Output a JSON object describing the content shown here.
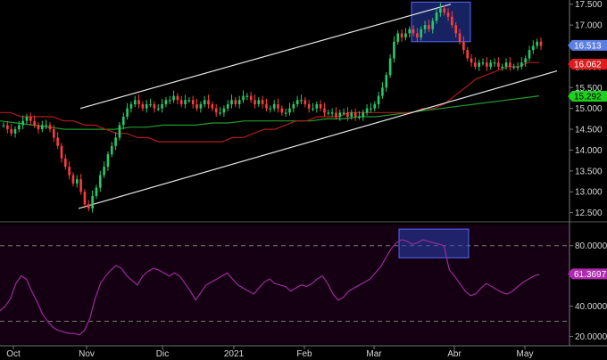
{
  "chart_data": [
    {
      "type": "candlestick",
      "panel": "price",
      "x_ticks": [
        "Oct",
        "Nov",
        "Dic",
        "2021",
        "Feb",
        "Mar",
        "Abr",
        "May"
      ],
      "y_ticks": [
        "12.500",
        "13.000",
        "13.500",
        "14.000",
        "14.500",
        "15.000",
        "15.500",
        "16.000",
        "16.500",
        "17.000",
        "17.500"
      ],
      "ylim": [
        12.3,
        17.6
      ],
      "labels": {
        "last": "16.513",
        "ma_fast": "16.062",
        "ma_slow": "15.292"
      },
      "colors": {
        "up": "#26c96a",
        "down": "#ff3b3b",
        "ma_fast": "#b01c1c",
        "ma_slow": "#1f9a2a",
        "channel": "#e6e6e6",
        "box_fill": "#2a3fb0",
        "box_edge": "#5566ff",
        "last_badge": "#5b7fe6",
        "ma_fast_badge": "#e01b1b",
        "ma_slow_badge": "#1fd01f"
      },
      "close_series": [
        14.6,
        14.5,
        14.4,
        14.5,
        14.6,
        14.7,
        14.8,
        14.7,
        14.6,
        14.5,
        14.6,
        14.6,
        14.5,
        14.3,
        14.1,
        13.8,
        13.6,
        13.4,
        13.2,
        13.3,
        13.0,
        12.7,
        12.6,
        12.9,
        13.1,
        13.4,
        13.6,
        13.9,
        14.1,
        14.3,
        14.6,
        14.8,
        15.0,
        15.1,
        15.2,
        15.1,
        15.0,
        15.1,
        15.1,
        15.0,
        15.0,
        15.1,
        15.2,
        15.2,
        15.3,
        15.2,
        15.1,
        15.2,
        15.2,
        15.1,
        15.0,
        15.1,
        15.2,
        15.1,
        15.0,
        14.9,
        14.9,
        15.0,
        15.1,
        15.2,
        15.1,
        15.2,
        15.3,
        15.3,
        15.2,
        15.1,
        15.2,
        15.1,
        15.0,
        15.0,
        15.1,
        15.0,
        14.9,
        14.9,
        15.0,
        15.1,
        15.2,
        15.2,
        15.1,
        15.0,
        15.0,
        15.1,
        15.0,
        14.9,
        14.9,
        14.9,
        14.8,
        14.9,
        14.9,
        14.8,
        14.9,
        14.8,
        14.8,
        14.9,
        15.0,
        15.0,
        15.1,
        15.3,
        15.5,
        15.8,
        16.2,
        16.6,
        16.8,
        16.7,
        16.8,
        16.9,
        16.8,
        16.7,
        16.9,
        17.0,
        16.9,
        17.1,
        17.3,
        17.4,
        17.3,
        17.2,
        17.0,
        16.8,
        16.6,
        16.4,
        16.2,
        16.1,
        16.0,
        16.1,
        16.1,
        16.0,
        16.1,
        16.1,
        16.0,
        16.0,
        16.1,
        16.0,
        16.0,
        16.0,
        16.1,
        16.2,
        16.4,
        16.5,
        16.6,
        16.5
      ],
      "ma_fast_series": [
        14.9,
        14.9,
        14.8,
        14.8,
        14.8,
        14.8,
        14.7,
        14.7,
        14.6,
        14.6,
        14.5,
        14.4,
        14.4,
        14.3,
        14.3,
        14.2,
        14.2,
        14.2,
        14.2,
        14.2,
        14.2,
        14.2,
        14.3,
        14.3,
        14.4,
        14.5,
        14.5,
        14.6,
        14.7,
        14.7,
        14.8,
        14.8,
        14.8,
        14.9,
        14.9,
        14.9,
        14.9,
        14.9,
        14.9,
        14.9,
        15.0,
        15.0,
        15.1,
        15.3,
        15.5,
        15.7,
        15.8,
        15.9,
        16.0,
        16.0,
        16.1,
        16.1
      ],
      "ma_slow_series": [
        14.7,
        14.65,
        14.6,
        14.55,
        14.5,
        14.5,
        14.5,
        14.5,
        14.55,
        14.55,
        14.6,
        14.6,
        14.6,
        14.65,
        14.65,
        14.7,
        14.7,
        14.7,
        14.7,
        14.7,
        14.75,
        14.75,
        14.8,
        14.8,
        14.85,
        14.9,
        14.95,
        15.0,
        15.05,
        15.1,
        15.15,
        15.2,
        15.25,
        15.3
      ],
      "channel_upper": [
        [
          12.6,
          15.0
        ],
        [
          17.6,
          17.5
        ]
      ],
      "channel_lower": [
        [
          12.5,
          12.6
        ],
        [
          17.3,
          15.9
        ]
      ],
      "highlight_box": [
        16.6,
        17.55
      ]
    },
    {
      "type": "line",
      "panel": "rsi",
      "y_ticks": [
        "20.0000",
        "40.0000",
        "60.0000",
        "80.0000"
      ],
      "ylim": [
        15,
        94
      ],
      "levels": [
        80,
        30
      ],
      "labels": {
        "last": "61.3697"
      },
      "colors": {
        "line": "#9b2a9b",
        "badge": "#b02ab0",
        "level": "#777777",
        "box_fill": "#2a3fb0",
        "box_edge": "#5566ff"
      },
      "values": [
        37,
        40,
        45,
        55,
        60,
        58,
        50,
        43,
        35,
        30,
        26,
        24,
        23,
        22,
        22,
        21,
        24,
        32,
        45,
        55,
        60,
        64,
        67,
        65,
        60,
        57,
        54,
        60,
        63,
        65,
        64,
        62,
        60,
        62,
        60,
        55,
        50,
        44,
        49,
        54,
        56,
        58,
        60,
        62,
        58,
        54,
        52,
        50,
        48,
        52,
        56,
        58,
        55,
        54,
        53,
        50,
        52,
        54,
        53,
        55,
        58,
        60,
        55,
        48,
        44,
        46,
        50,
        52,
        54,
        56,
        58,
        62,
        66,
        72,
        78,
        82,
        84,
        83,
        81,
        82,
        84,
        83,
        82,
        81,
        80,
        64,
        60,
        55,
        50,
        47,
        48,
        52,
        55,
        53,
        51,
        49,
        48,
        50,
        53,
        56,
        58,
        60,
        61
      ]
    }
  ]
}
